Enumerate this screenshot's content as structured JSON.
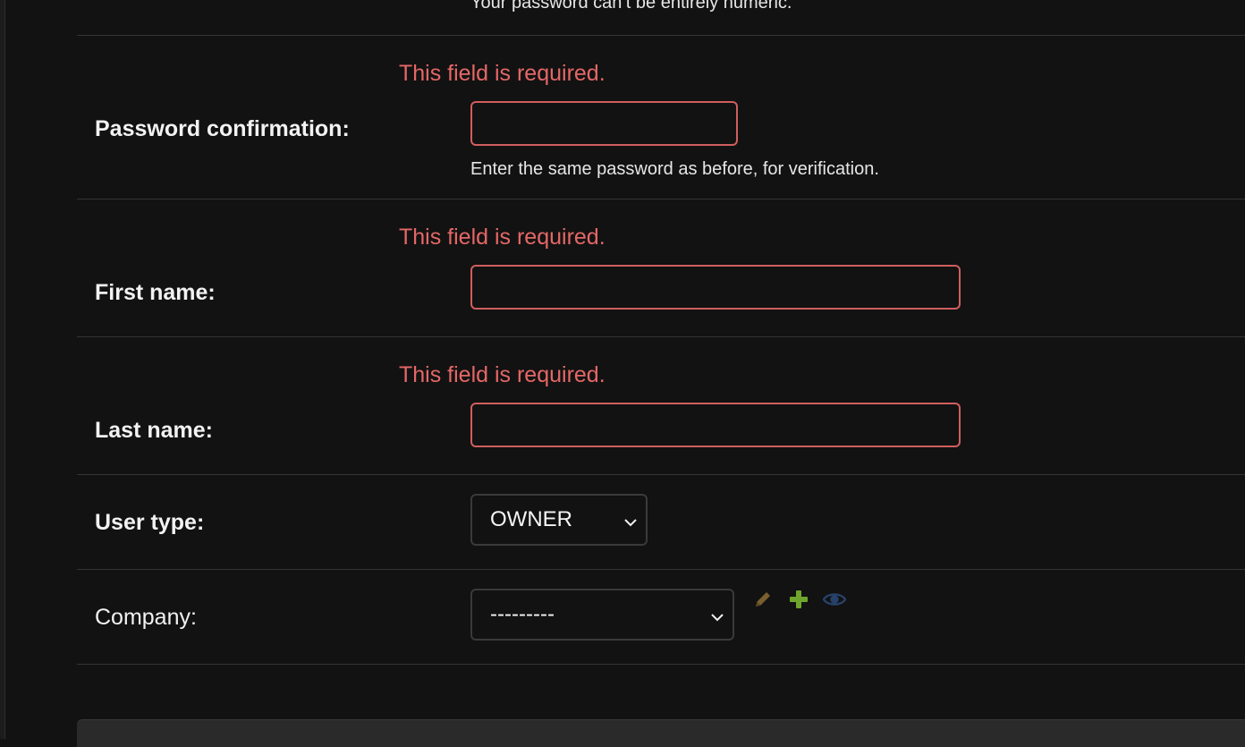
{
  "password_help_cut": "Your password can’t be entirely numeric.",
  "password_confirmation": {
    "error": "This field is required.",
    "label": "Password confirmation:",
    "help": "Enter the same password as before, for verification.",
    "value": ""
  },
  "first_name": {
    "error": "This field is required.",
    "label": "First name:",
    "value": ""
  },
  "last_name": {
    "error": "This field is required.",
    "label": "Last name:",
    "value": ""
  },
  "user_type": {
    "label": "User type:",
    "selected": "OWNER"
  },
  "company": {
    "label": "Company:",
    "selected": "---------",
    "actions": {
      "edit_icon": "pencil-icon",
      "add_icon": "plus-icon",
      "view_icon": "eye-icon"
    }
  },
  "colors": {
    "background": "#121212",
    "error": "#e56767",
    "error_border": "#d05e5e",
    "edit": "#7a5f2e",
    "add": "#6fa52c",
    "view": "#27426a"
  }
}
